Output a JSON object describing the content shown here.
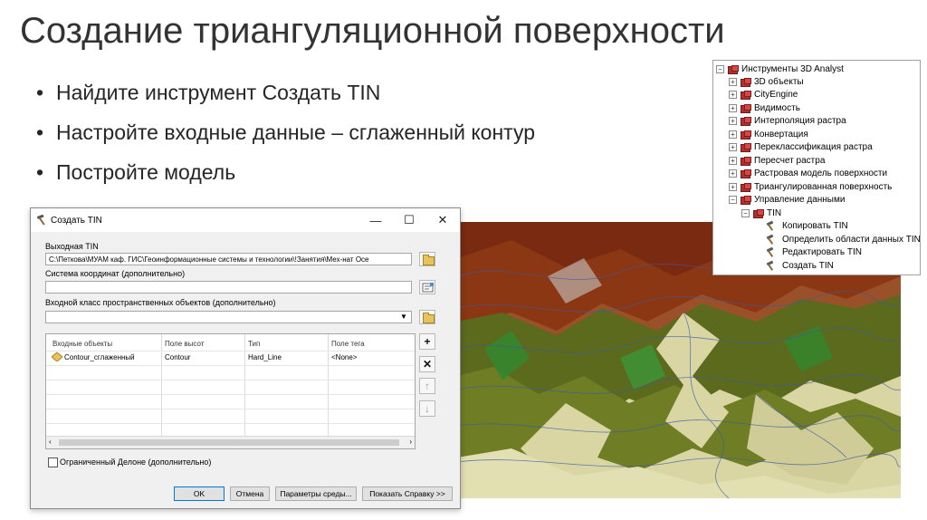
{
  "slide": {
    "title": "Создание триангуляционной поверхности",
    "bullets": [
      "Найдите инструмент Создать TIN",
      "Настройте входные данные – сглаженный контур",
      "Постройте модель"
    ]
  },
  "toolbox_tree": {
    "root": "Инструменты 3D Analyst",
    "items": [
      "3D объекты",
      "CityEngine",
      "Видимость",
      "Интерполяция растра",
      "Конвертация",
      "Переклассификация растра",
      "Пересчет растра",
      "Растровая модель поверхности",
      "Триангулированная поверхность",
      "Управление данными"
    ],
    "subfolder": "TIN",
    "tools": [
      "Копировать TIN",
      "Определить области данных TIN",
      "Редактировать TIN",
      "Создать TIN"
    ]
  },
  "dialog": {
    "title": "Создать TIN",
    "output_label": "Выходная TIN",
    "output_value": "C:\\Петкова\\МУАМ каф. ГИС\\Геоинформационные системы и технологии\\!Занятия\\Мех-нат Осе",
    "crs_label": "Система координат (дополнительно)",
    "crs_value": "",
    "input_label": "Входной класс пространственных объектов (дополнительно)",
    "input_value": "",
    "columns": [
      "Входные объекты",
      "Поле высот",
      "Тип",
      "Поле тега"
    ],
    "rows": [
      [
        "Contour_сглаженный",
        "Contour",
        "Hard_Line",
        "<None>"
      ]
    ],
    "constrained_label": "Ограниченный Делоне (дополнительно)",
    "constrained_checked": false,
    "buttons": {
      "ok": "OK",
      "cancel": "Отмена",
      "env": "Параметры среды...",
      "help": "Показать Справку >>"
    }
  },
  "colors": {
    "title_text": "#333333",
    "dialog_bg": "#f0f0f0",
    "terrain_high": "#7a2a10",
    "terrain_mid": "#5c6a1e",
    "terrain_low": "#d9d6a4",
    "contour": "#3a5aa8"
  }
}
